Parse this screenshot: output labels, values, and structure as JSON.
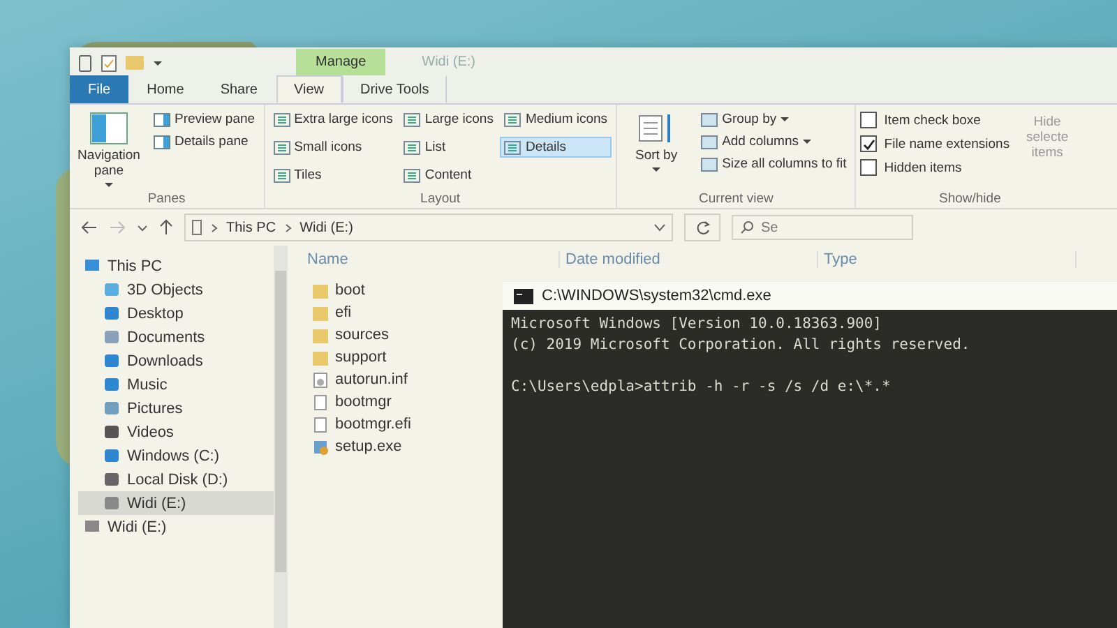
{
  "window": {
    "title": "Widi (E:)",
    "contextual_header": "Manage"
  },
  "tabs": [
    {
      "label": "File",
      "kind": "file",
      "selected": false
    },
    {
      "label": "Home",
      "kind": "tab",
      "selected": false
    },
    {
      "label": "Share",
      "kind": "tab",
      "selected": false
    },
    {
      "label": "View",
      "kind": "tab",
      "selected": true
    },
    {
      "label": "Drive Tools",
      "kind": "contextual",
      "selected": false
    }
  ],
  "panes": {
    "label": "Panes",
    "navigation_pane": "Navigation pane",
    "items": [
      "Preview pane",
      "Details pane"
    ]
  },
  "layout": {
    "label": "Layout",
    "options": [
      {
        "label": "Extra large icons",
        "selected": false
      },
      {
        "label": "Large icons",
        "selected": false
      },
      {
        "label": "Medium icons",
        "selected": false
      },
      {
        "label": "Small icons",
        "selected": false
      },
      {
        "label": "List",
        "selected": false
      },
      {
        "label": "Details",
        "selected": true
      },
      {
        "label": "Tiles",
        "selected": false
      },
      {
        "label": "Content",
        "selected": false
      }
    ]
  },
  "current_view": {
    "label": "Current view",
    "sort_by": "Sort by",
    "items": [
      {
        "label": "Group by",
        "dropdown": true
      },
      {
        "label": "Add columns",
        "dropdown": true
      },
      {
        "label": "Size all columns to fit",
        "dropdown": false
      }
    ]
  },
  "show_hide": {
    "label": "Show/hide",
    "checkboxes": [
      {
        "label": "Item check boxe",
        "checked": false
      },
      {
        "label": "File name extensions",
        "checked": true
      },
      {
        "label": "Hidden items",
        "checked": false
      }
    ],
    "hide_selected": "Hide selecte items"
  },
  "address": {
    "path": [
      "This PC",
      "Widi (E:)"
    ],
    "search_placeholder": "Se"
  },
  "navigation": [
    {
      "label": "This PC",
      "kind": "pc",
      "selected": false,
      "children": [
        {
          "label": "3D Objects",
          "kind": "objects",
          "selected": false
        },
        {
          "label": "Desktop",
          "kind": "desktop",
          "selected": false
        },
        {
          "label": "Documents",
          "kind": "documents",
          "selected": false
        },
        {
          "label": "Downloads",
          "kind": "downloads",
          "selected": false
        },
        {
          "label": "Music",
          "kind": "music",
          "selected": false
        },
        {
          "label": "Pictures",
          "kind": "pictures",
          "selected": false
        },
        {
          "label": "Videos",
          "kind": "videos",
          "selected": false
        },
        {
          "label": "Windows (C:)",
          "kind": "system",
          "selected": false
        },
        {
          "label": "Local Disk (D:)",
          "kind": "disk",
          "selected": false
        },
        {
          "label": "Widi (E:)",
          "kind": "usb",
          "selected": true
        }
      ]
    },
    {
      "label": "Widi (E:)",
      "kind": "usb",
      "selected": false
    }
  ],
  "columns": [
    "Name",
    "Date modified",
    "Type"
  ],
  "files": [
    {
      "name": "boot",
      "kind": "folder"
    },
    {
      "name": "efi",
      "kind": "folder"
    },
    {
      "name": "sources",
      "kind": "folder"
    },
    {
      "name": "support",
      "kind": "folder"
    },
    {
      "name": "autorun.inf",
      "kind": "settings"
    },
    {
      "name": "bootmgr",
      "kind": "file"
    },
    {
      "name": "bootmgr.efi",
      "kind": "file"
    },
    {
      "name": "setup.exe",
      "kind": "setup"
    }
  ],
  "console": {
    "title": "C:\\WINDOWS\\system32\\cmd.exe",
    "banner": [
      "Microsoft Windows [Version 10.0.18363.900]",
      "(c) 2019 Microsoft Corporation. All rights reserved."
    ],
    "prompt": "C:\\Users\\edpla>attrib -h -r -s /s /d e:\\*.*"
  }
}
